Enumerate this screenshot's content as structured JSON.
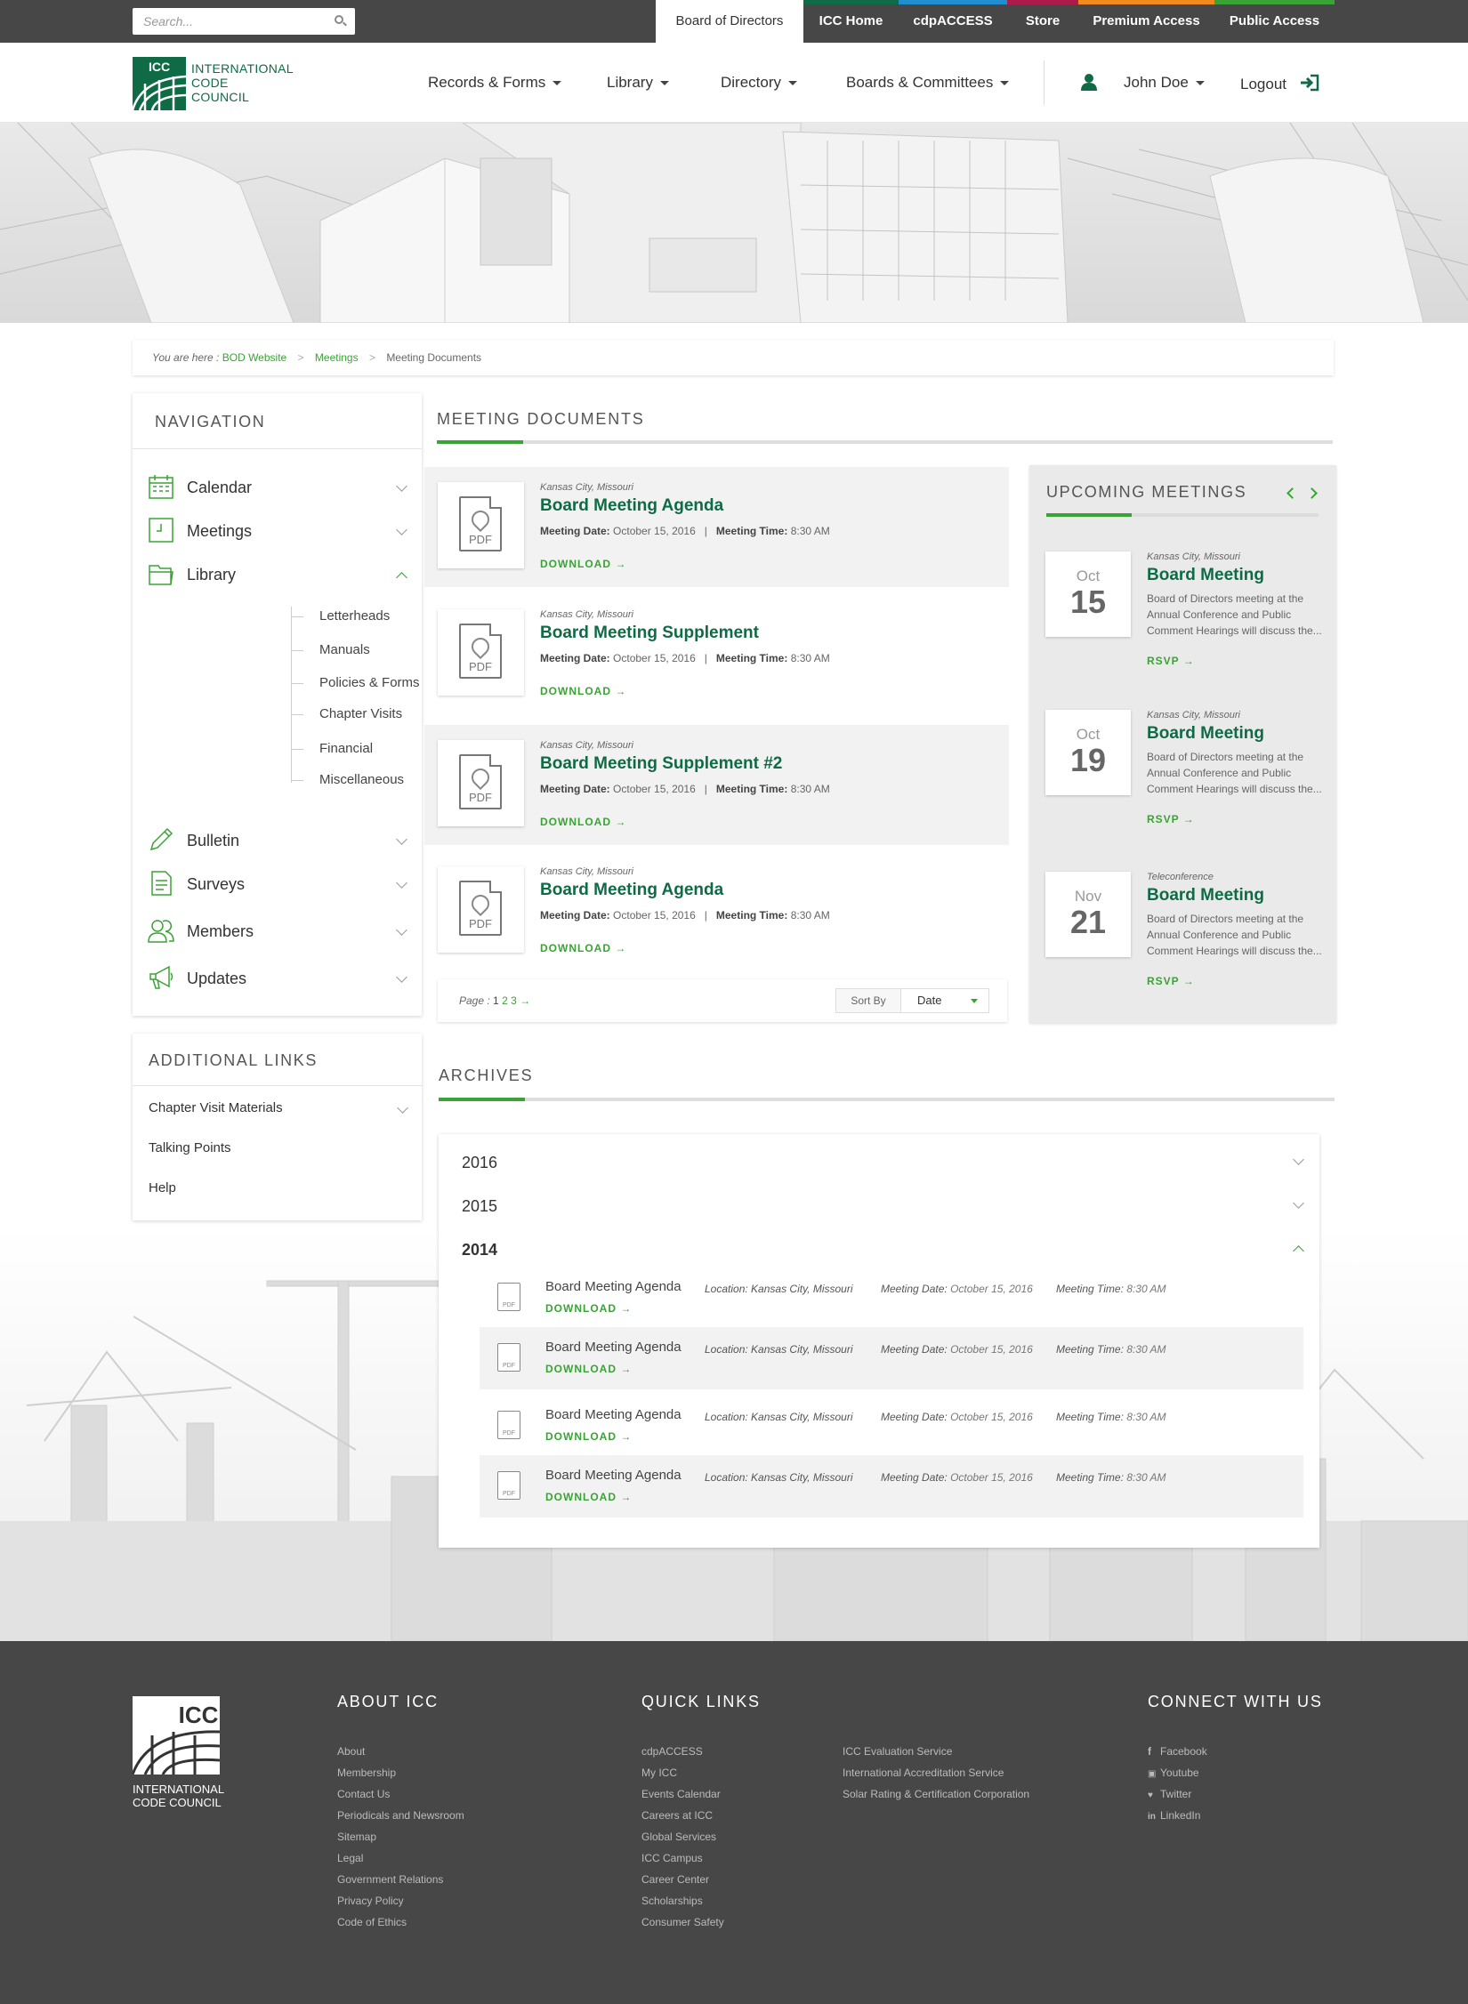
{
  "topbar": {
    "search_placeholder": "Search...",
    "links": [
      {
        "label": "Board of Directors",
        "color": "#ffffff"
      },
      {
        "label": "ICC Home",
        "color": "#0f6b45"
      },
      {
        "label": "cdpACCESS",
        "color": "#1f8fd0"
      },
      {
        "label": "Store",
        "color": "#b01a4b"
      },
      {
        "label": "Premium Access",
        "color": "#f08a1d"
      },
      {
        "label": "Public Access",
        "color": "#3aa335"
      }
    ]
  },
  "header": {
    "logo_text": [
      "INTERNATIONAL",
      "CODE",
      "COUNCIL"
    ],
    "logo_mark": "ICC",
    "nav": [
      "Records & Forms",
      "Library",
      "Directory",
      "Boards & Committees"
    ],
    "user": "John Doe",
    "logout": "Logout"
  },
  "breadcrumb": {
    "prefix": "You are here :",
    "items": [
      "BOD Website",
      "Meetings",
      "Meeting Documents"
    ]
  },
  "sidebar": {
    "title": "NAVIGATION",
    "items": [
      {
        "label": "Calendar",
        "icon": "calendar-icon"
      },
      {
        "label": "Meetings",
        "icon": "clock-icon"
      },
      {
        "label": "Library",
        "icon": "folder-icon"
      },
      {
        "label": "Bulletin",
        "icon": "pencil-icon"
      },
      {
        "label": "Surveys",
        "icon": "survey-icon"
      },
      {
        "label": "Members",
        "icon": "members-icon"
      },
      {
        "label": "Updates",
        "icon": "megaphone-icon"
      }
    ],
    "library_sub": [
      "Letterheads",
      "Manuals",
      "Policies & Forms",
      "Chapter Visits",
      "Financial",
      "Miscellaneous"
    ]
  },
  "additional_links": {
    "title": "ADDITIONAL LINKS",
    "items": [
      "Chapter Visit Materials",
      "Talking Points",
      "Help"
    ]
  },
  "meeting_documents": {
    "title": "MEETING DOCUMENTS",
    "docs": [
      {
        "location": "Kansas City, Missouri",
        "title": "Board Meeting Agenda",
        "date_label": "Meeting Date:",
        "date": "October 15, 2016",
        "time_label": "Meeting Time:",
        "time": "8:30 AM",
        "download": "DOWNLOAD →"
      },
      {
        "location": "Kansas City, Missouri",
        "title": "Board Meeting Supplement",
        "date_label": "Meeting Date:",
        "date": "October 15, 2016",
        "time_label": "Meeting Time:",
        "time": "8:30 AM",
        "download": "DOWNLOAD →"
      },
      {
        "location": "Kansas City, Missouri",
        "title": "Board Meeting Supplement #2",
        "date_label": "Meeting Date:",
        "date": "October 15, 2016",
        "time_label": "Meeting Time:",
        "time": "8:30 AM",
        "download": "DOWNLOAD →"
      },
      {
        "location": "Kansas City, Missouri",
        "title": "Board Meeting Agenda",
        "date_label": "Meeting Date:",
        "date": "October 15, 2016",
        "time_label": "Meeting Time:",
        "time": "8:30 AM",
        "download": "DOWNLOAD →"
      }
    ],
    "pdf_label": "PDF",
    "pager": {
      "label": "Page :",
      "pages": [
        "1",
        "2",
        "3"
      ],
      "next": "→",
      "sort_label": "Sort By",
      "sort_value": "Date"
    }
  },
  "upcoming": {
    "title": "UPCOMING MEETINGS",
    "meetings": [
      {
        "month": "Oct",
        "day": "15",
        "location": "Kansas City, Missouri",
        "title": "Board Meeting",
        "desc": [
          "Board of Directors meeting at the",
          "Annual Conference and Public",
          "Comment Hearings will discuss the..."
        ],
        "rsvp": "RSVP →"
      },
      {
        "month": "Oct",
        "day": "19",
        "location": "Kansas City, Missouri",
        "title": "Board Meeting",
        "desc": [
          "Board of Directors meeting at the",
          "Annual Conference and Public",
          "Comment Hearings will discuss the..."
        ],
        "rsvp": "RSVP →"
      },
      {
        "month": "Nov",
        "day": "21",
        "location": "Teleconference",
        "title": "Board Meeting",
        "desc": [
          "Board of Directors meeting at the",
          "Annual Conference and Public",
          "Comment Hearings will discuss the..."
        ],
        "rsvp": "RSVP →"
      }
    ]
  },
  "archives": {
    "title": "ARCHIVES",
    "years": [
      "2016",
      "2015",
      "2014"
    ],
    "rows": [
      {
        "title": "Board Meeting Agenda",
        "download": "DOWNLOAD →",
        "location": "Location: Kansas City, Missouri",
        "date_label": "Meeting Date:",
        "date": "October 15, 2016",
        "time_label": "Meeting Time:",
        "time": "8:30 AM"
      },
      {
        "title": "Board Meeting Agenda",
        "download": "DOWNLOAD →",
        "location": "Location: Kansas City, Missouri",
        "date_label": "Meeting Date:",
        "date": "October 15, 2016",
        "time_label": "Meeting Time:",
        "time": "8:30 AM"
      },
      {
        "title": "Board Meeting Agenda",
        "download": "DOWNLOAD →",
        "location": "Location: Kansas City, Missouri",
        "date_label": "Meeting Date:",
        "date": "October 15, 2016",
        "time_label": "Meeting Time:",
        "time": "8:30 AM"
      },
      {
        "title": "Board Meeting Agenda",
        "download": "DOWNLOAD →",
        "location": "Location: Kansas City, Missouri",
        "date_label": "Meeting Date:",
        "date": "October 15, 2016",
        "time_label": "Meeting Time:",
        "time": "8:30 AM"
      }
    ]
  },
  "footer": {
    "logo": [
      "INTERNATIONAL",
      "CODE COUNCIL"
    ],
    "about_title": "ABOUT ICC",
    "about": [
      "About",
      "Membership",
      "Contact Us",
      "Periodicals and Newsroom",
      "Sitemap",
      "Legal",
      "Government Relations",
      "Privacy Policy",
      "Code of Ethics"
    ],
    "quick_title": "QUICK LINKS",
    "quick1": [
      "cdpACCESS",
      "My ICC",
      "Events Calendar",
      "Careers at ICC",
      "Global Services",
      "ICC Campus",
      "Career Center",
      "Scholarships",
      "Consumer Safety"
    ],
    "quick2": [
      "ICC Evaluation Service",
      "International Accreditation Service",
      "Solar Rating & Certification Corporation"
    ],
    "connect_title": "CONNECT WITH US",
    "social": [
      {
        "icon": "facebook-icon",
        "label": "Facebook",
        "glyph": "f"
      },
      {
        "icon": "youtube-icon",
        "label": "Youtube",
        "glyph": "▣"
      },
      {
        "icon": "twitter-icon",
        "label": "Twitter",
        "glyph": "♥"
      },
      {
        "icon": "linkedin-icon",
        "label": "LinkedIn",
        "glyph": "in"
      }
    ]
  },
  "colors": {
    "accent": "#3aa335",
    "brand": "#0f6b45",
    "topbar": "#474747"
  }
}
